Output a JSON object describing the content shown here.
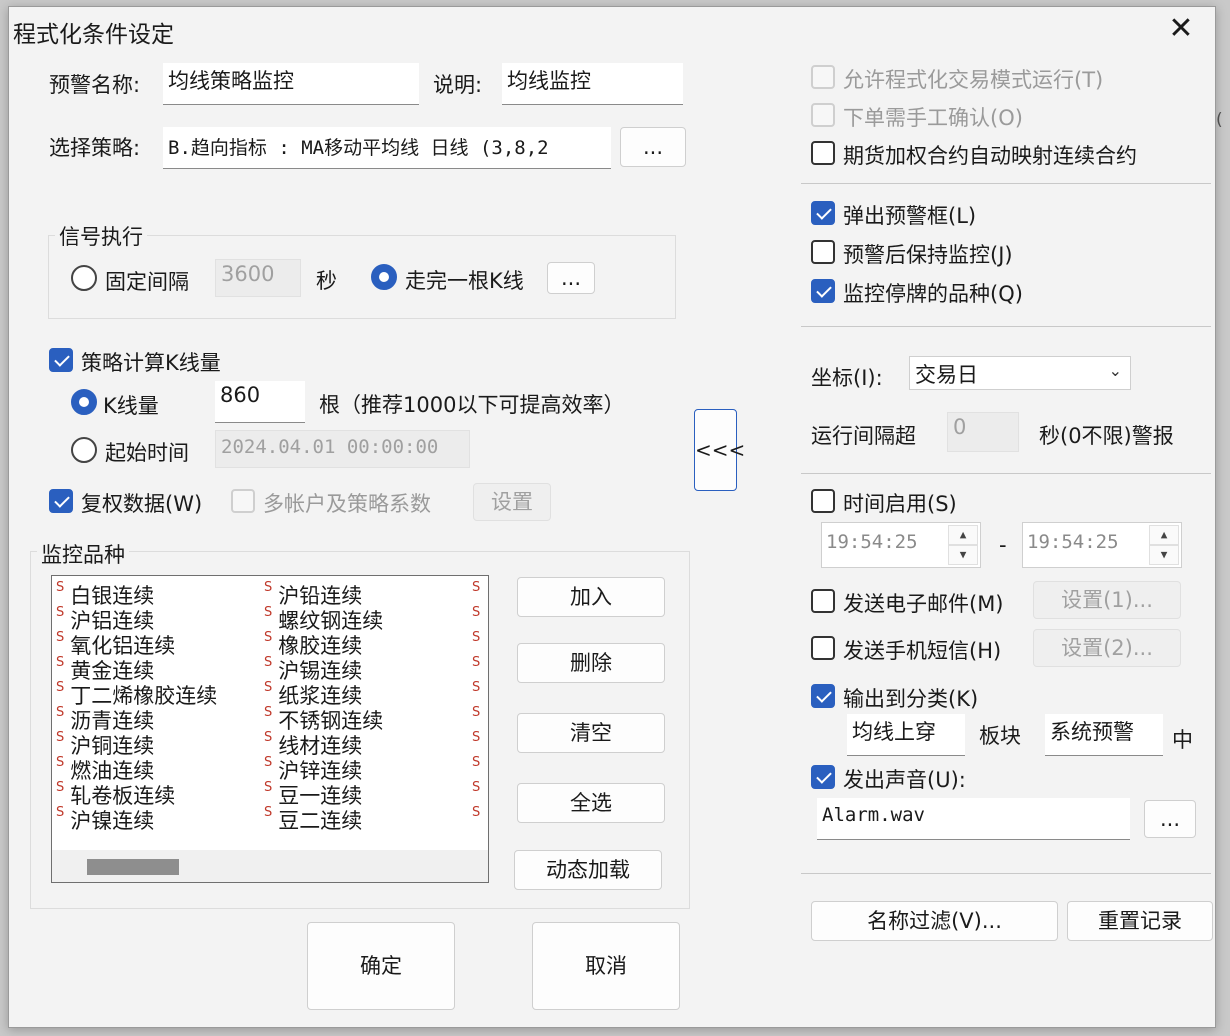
{
  "window": {
    "title": "程式化条件设定",
    "close_icon": "close-icon"
  },
  "left": {
    "alert_name_label": "预警名称:",
    "alert_name_value": "均线策略监控",
    "desc_label": "说明:",
    "desc_value": "均线监控",
    "strategy_label": "选择策略:",
    "strategy_value": "B.趋向指标 : MA移动平均线 日线 (3,8,2",
    "strategy_browse": "...",
    "signal_group": "信号执行",
    "fixed_interval_label": "固定间隔",
    "fixed_interval_value": "3600",
    "seconds_label": "秒",
    "kline_complete_label": "走完一根K线",
    "kline_complete_btn": "...",
    "calc_kline_label": "策略计算K线量",
    "kline_count_label": "K线量",
    "kline_count_value": "860",
    "kline_count_hint": "根（推荐1000以下可提高效率）",
    "start_time_label": "起始时间",
    "start_time_value": "2024.04.01 00:00:00",
    "adjust_label": "复权数据(W)",
    "multi_account_label": "多帐户及策略系数",
    "setup_btn": "设置",
    "monitor_group": "监控品种",
    "list_col1": [
      "白银连续",
      "沪铝连续",
      "氧化铝连续",
      "黄金连续",
      "丁二烯橡胶连续",
      "沥青连续",
      "沪铜连续",
      "燃油连续",
      "轧卷板连续",
      "沪镍连续"
    ],
    "list_col2": [
      "沪铅连续",
      "螺纹钢连续",
      "橡胶连续",
      "沪锡连续",
      "纸浆连续",
      "不锈钢连续",
      "线材连续",
      "沪锌连续",
      "豆一连续",
      "豆二连续"
    ],
    "list_marker": "S",
    "add_btn": "加入",
    "delete_btn": "删除",
    "clear_btn": "清空",
    "select_all_btn": "全选",
    "dynamic_load_btn": "动态加载",
    "ok_btn": "确定",
    "cancel_btn": "取消",
    "collapse_btn": "<<<"
  },
  "right": {
    "allow_trade_mode": "允许程式化交易模式运行(T)",
    "manual_confirm": "下单需手工确认(O)",
    "futures_map": "期货加权合约自动映射连续合约",
    "popup_alert": "弹出预警框(L)",
    "keep_monitor": "预警后保持监控(J)",
    "monitor_suspended": "监控停牌的品种(Q)",
    "coord_label": "坐标(I):",
    "coord_value": "交易日",
    "interval_label": "运行间隔超",
    "interval_value": "0",
    "interval_suffix": "秒(0不限)警报",
    "time_enable": "时间启用(S)",
    "time_start": "19:54:25",
    "time_dash": "-",
    "time_end": "19:54:25",
    "send_email": "发送电子邮件(M)",
    "email_setup": "设置(1)...",
    "send_sms": "发送手机短信(H)",
    "sms_setup": "设置(2)...",
    "output_category": "输出到分类(K)",
    "category_value": "均线上穿",
    "board_label": "板块",
    "board_value": "系统预警",
    "mid_label": "中",
    "play_sound": "发出声音(U):",
    "sound_file": "Alarm.wav",
    "sound_browse": "...",
    "name_filter_btn": "名称过滤(V)...",
    "reset_record_btn": "重置记录"
  },
  "checks": {
    "allow_trade_mode": false,
    "manual_confirm": false,
    "futures_map": false,
    "popup_alert": true,
    "keep_monitor": false,
    "monitor_suspended": true,
    "time_enable": false,
    "send_email": false,
    "send_sms": false,
    "output_category": true,
    "play_sound": true,
    "calc_kline": true,
    "adjust": true,
    "multi_account": false
  },
  "colors": {
    "accent": "#2a5fbf",
    "disabled_text": "#9a9a9a",
    "marker": "#c0392b"
  }
}
